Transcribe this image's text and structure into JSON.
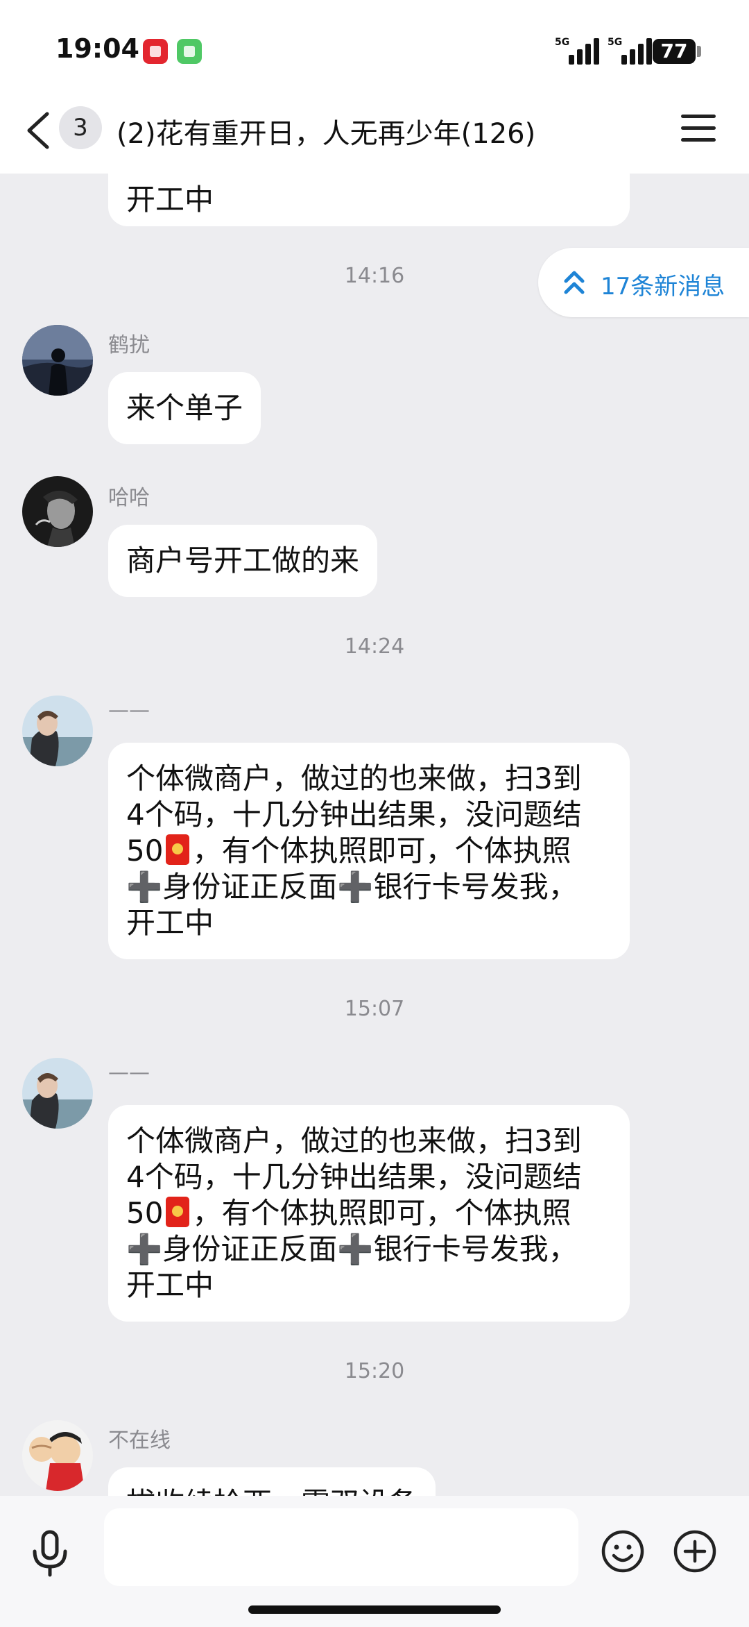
{
  "status_bar": {
    "time": "19:04",
    "signal1_label": "5G",
    "signal2_label": "5G",
    "battery": "77"
  },
  "header": {
    "unread_count": "3",
    "title": "(2)花有重开日，人无再少年(126)"
  },
  "new_messages": {
    "label": "17条新消息",
    "color": "#1e84d6"
  },
  "chat": {
    "partial_top": "开工中",
    "ts1": "14:16",
    "msg1": {
      "sender": "鹤扰",
      "text": "来个单子"
    },
    "msg2": {
      "sender": "哈哈",
      "text": "商户号开工做的来"
    },
    "ts2": "14:24",
    "msg3": {
      "sender": "——",
      "line1": "个体微商户，做过的也来做，扫3到",
      "line2": "4个码，十几分钟出结果，没问题结",
      "line3a": "50",
      "line3b": "，有个体执照即可，个体执照",
      "line4": "➕身份证正反面➕银行卡号发我，",
      "line5": "开工中"
    },
    "ts3": "15:07",
    "msg4": {
      "sender": "——",
      "line1": "个体微商户，做过的也来做，扫3到",
      "line2": "4个码，十几分钟出结果，没问题结",
      "line3a": "50",
      "line3b": "，有个体执照即可，个体执照",
      "line4": "➕身份证正反面➕银行卡号发我，",
      "line5": "开工中"
    },
    "ts4": "15:20",
    "msg5": {
      "sender": "不在线",
      "text": "拔收续拾西，需双设备"
    }
  },
  "input": {
    "placeholder": ""
  },
  "colors": {
    "background": "#ededf0",
    "bubble": "#ffffff",
    "accent": "#1e84d6"
  }
}
